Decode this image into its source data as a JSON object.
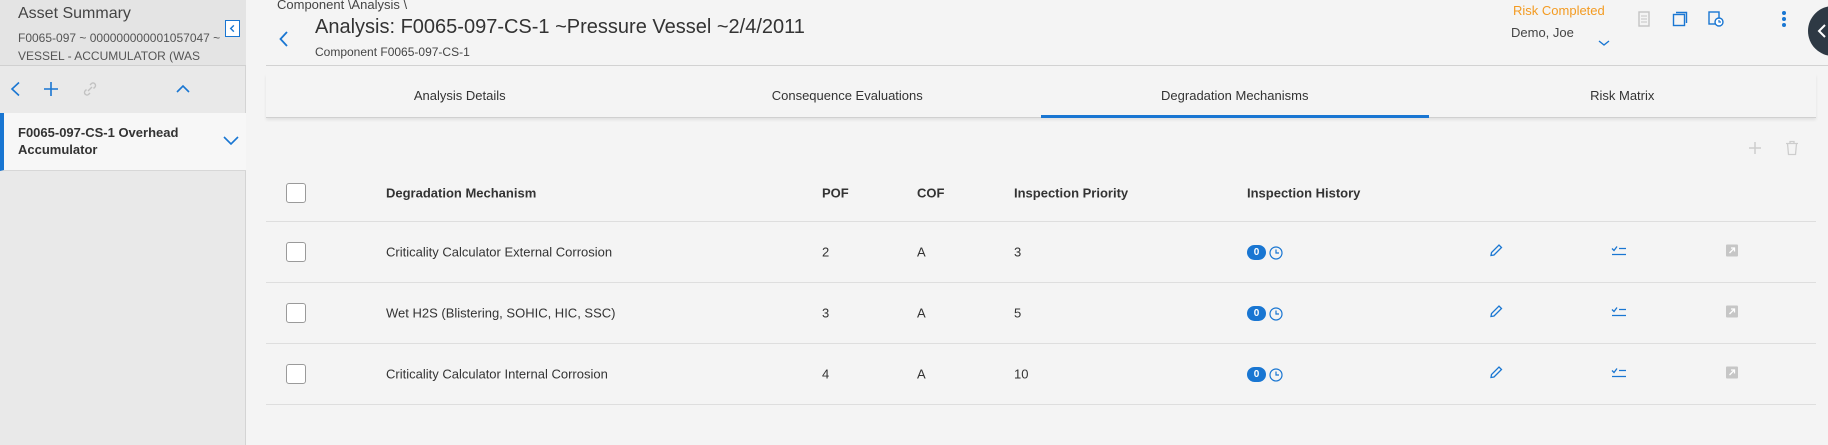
{
  "left_panel": {
    "title": "Asset Summary",
    "subtitle": "F0065-097 ~ 000000000001057047 ~ VESSEL - ACCUMULATOR (WAS",
    "tree_item_label": "F0065-097-CS-1 Overhead Accumulator"
  },
  "header": {
    "breadcrumb": "Component \\Analysis \\",
    "title": "Analysis: F0065-097-CS-1 ~Pressure Vessel ~2/4/2011",
    "subtitle": "Component F0065-097-CS-1",
    "risk_status": "Risk Completed",
    "user": "Demo, Joe"
  },
  "tabs": [
    {
      "label": "Analysis Details"
    },
    {
      "label": "Consequence Evaluations"
    },
    {
      "label": "Degradation Mechanisms"
    },
    {
      "label": "Risk Matrix"
    }
  ],
  "active_tab": "Degradation Mechanisms",
  "table": {
    "headers": {
      "mechanism": "Degradation Mechanism",
      "pof": "POF",
      "cof": "COF",
      "priority": "Inspection Priority",
      "history": "Inspection History"
    },
    "rows": [
      {
        "mechanism": "Criticality Calculator External Corrosion",
        "pof": "2",
        "cof": "A",
        "priority": "3",
        "history_count": "0"
      },
      {
        "mechanism": "Wet H2S (Blistering, SOHIC, HIC, SSC)",
        "pof": "3",
        "cof": "A",
        "priority": "5",
        "history_count": "0"
      },
      {
        "mechanism": "Criticality Calculator Internal Corrosion",
        "pof": "4",
        "cof": "A",
        "priority": "10",
        "history_count": "0"
      }
    ]
  },
  "colors": {
    "accent": "#1976d2",
    "status_orange": "#f39b22"
  }
}
